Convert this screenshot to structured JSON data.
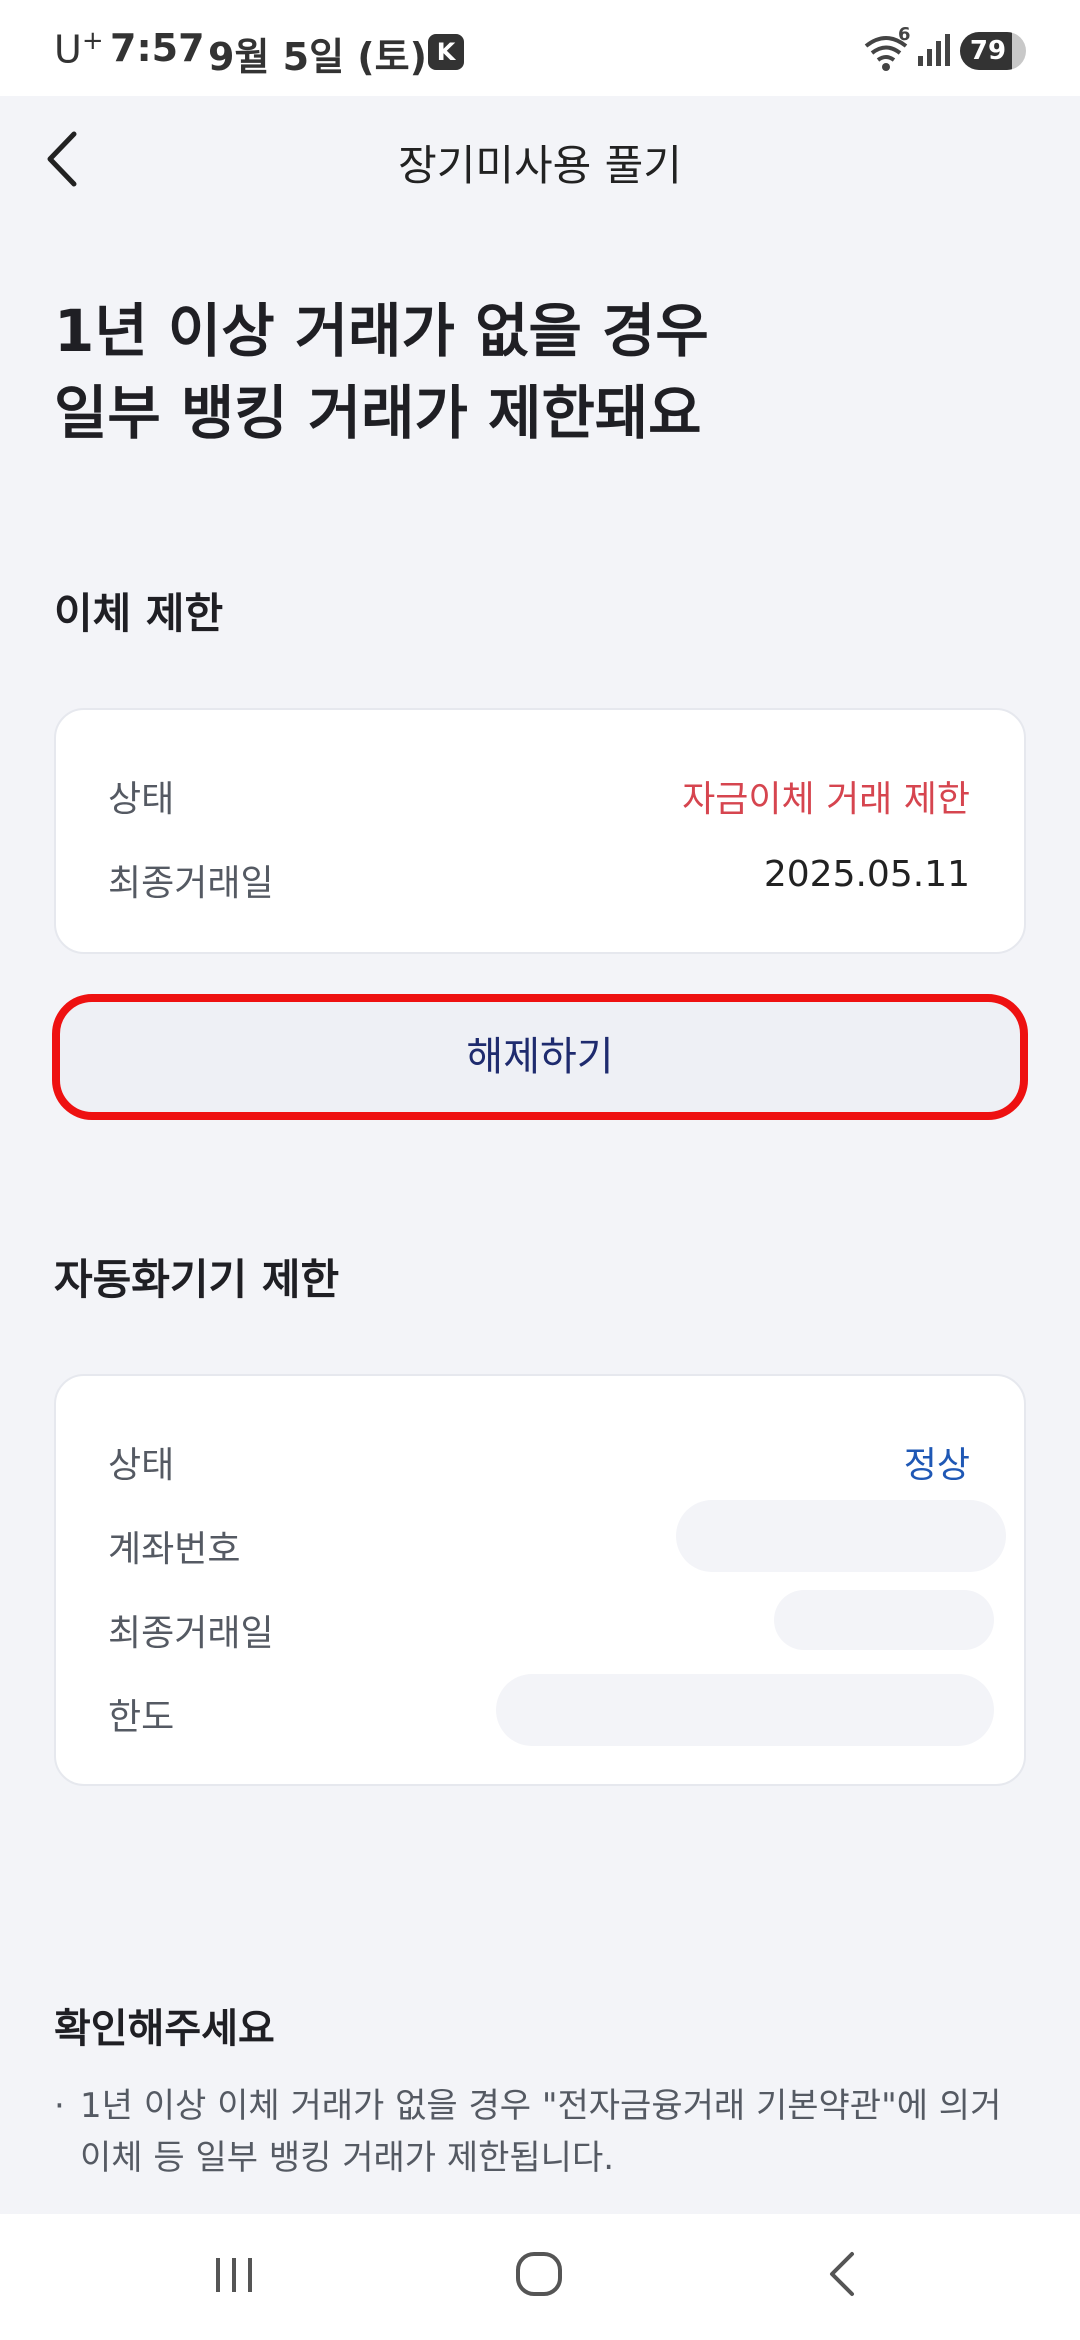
{
  "status_bar": {
    "carrier": "U",
    "carrier_sup": "+",
    "time": "7:57",
    "date": "9월 5일 (토)",
    "app_badge": "K",
    "wifi_badge": "6",
    "battery": "79",
    "battery_level": 0.79,
    "icons": [
      "wifi-icon",
      "signal-icon",
      "battery-icon"
    ]
  },
  "header": {
    "title": "장기미사용 풀기",
    "back_icon": "chevron-left-icon"
  },
  "headline": {
    "line1": "1년 이상 거래가 없을 경우",
    "line2": "일부 뱅킹 거래가 제한돼요"
  },
  "transfer": {
    "section_title": "이체 제한",
    "rows": [
      {
        "label": "상태",
        "value": "자금이체 거래 제한"
      },
      {
        "label": "최종거래일",
        "value": "2025.05.11"
      }
    ],
    "button_label": "해제하기"
  },
  "atm": {
    "section_title": "자동화기기 제한",
    "rows": [
      {
        "label": "상태",
        "value": "정상"
      },
      {
        "label": "계좌번호"
      },
      {
        "label": "최종거래일"
      },
      {
        "label": "한도"
      }
    ]
  },
  "notice": {
    "title": "확인해주세요",
    "bullet": "·",
    "items": [
      "1년 이상 이체 거래가 없을 경우 \"전자금융거래 기본약관\"에 의거 이체 등 일부 뱅킹 거래가 제한됩니다."
    ]
  },
  "nav": {
    "icons": [
      "recent-apps-icon",
      "home-icon",
      "back-icon"
    ]
  },
  "colors": {
    "background": "#f3f4f8",
    "restricted_red": "#d6454f",
    "normal_blue": "#1f58b5",
    "button_text": "#1e2b6e",
    "highlight_border": "#ee1111"
  }
}
